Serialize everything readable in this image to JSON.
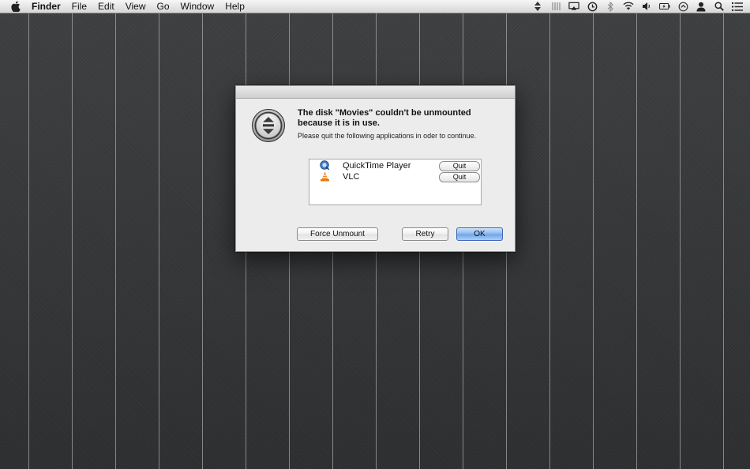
{
  "menubar": {
    "apple_icon": "apple-icon",
    "items": [
      "Finder",
      "File",
      "Edit",
      "View",
      "Go",
      "Window",
      "Help"
    ],
    "status_icons": [
      "input-menu-icon",
      "dashes-icon",
      "airplay-icon",
      "time-machine-icon",
      "bluetooth-icon",
      "wifi-icon",
      "volume-icon",
      "battery-icon",
      "sync-icon",
      "user-icon",
      "spotlight-icon",
      "notification-center-icon"
    ]
  },
  "dialog": {
    "icon": "eject-disk-icon",
    "headline": "The disk \"Movies\" couldn't be unmounted because it is in use.",
    "info": "Please quit the following applications in oder to continue.",
    "apps": [
      {
        "name": "QuickTime Player",
        "icon": "quicktime-icon",
        "quit_label": "Quit"
      },
      {
        "name": "VLC",
        "icon": "vlc-icon",
        "quit_label": "Quit"
      }
    ],
    "buttons": {
      "force": "Force Unmount",
      "retry": "Retry",
      "ok": "OK"
    }
  },
  "colors": {
    "desktop": "#3a3b3d",
    "dialog_bg": "#ececec",
    "default_button": "#6ea5ea"
  }
}
